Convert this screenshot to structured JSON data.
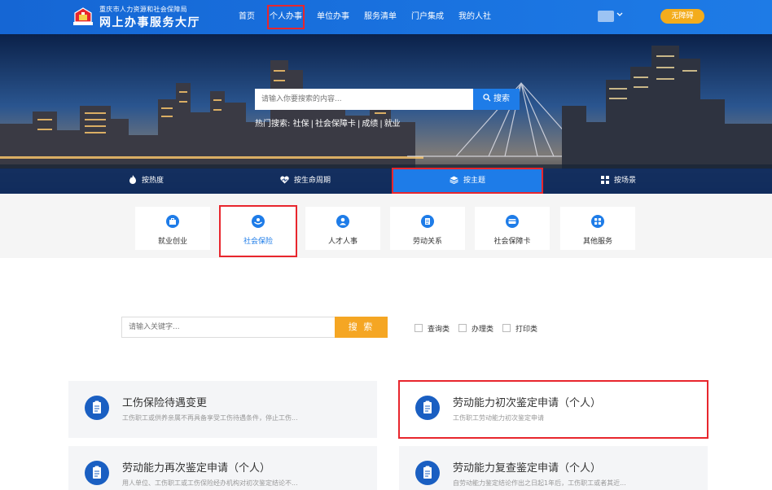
{
  "header": {
    "brand_sub": "重庆市人力资源和社会保障局",
    "brand_title": "网上办事服务大厅",
    "nav": [
      "首页",
      "个人办事",
      "单位办事",
      "服务清单",
      "门户集成",
      "我的人社"
    ],
    "active_nav": "个人办事",
    "access_label": "无障碍"
  },
  "hero": {
    "search_placeholder": "请输入你要搜索的内容...",
    "search_button": "搜索",
    "hot_label": "热门搜索:",
    "hot_items": [
      "社保",
      "社会保障卡",
      "成绩",
      "就业"
    ],
    "tabs": [
      "按热度",
      "按生命周期",
      "按主题",
      "按场景"
    ],
    "active_tab": "按主题"
  },
  "categories": {
    "items": [
      "就业创业",
      "社会保险",
      "人才人事",
      "劳动关系",
      "社会保障卡",
      "其他服务"
    ],
    "active": "社会保险"
  },
  "filter": {
    "placeholder": "请输入关键字...",
    "button": "搜 索",
    "checkboxes": [
      "查询类",
      "办理类",
      "打印类"
    ]
  },
  "cards": [
    {
      "title": "工伤保险待遇变更",
      "desc": "工伤职工或供养亲属不再具备享受工伤待遇条件，停止工伤..."
    },
    {
      "title": "劳动能力初次鉴定申请（个人）",
      "desc": "工伤职工劳动能力初次鉴定申请"
    },
    {
      "title": "劳动能力再次鉴定申请（个人）",
      "desc": "用人单位、工伤职工或工伤保险经办机构对初次鉴定结论不..."
    },
    {
      "title": "劳动能力复查鉴定申请（个人）",
      "desc": "自劳动能力鉴定结论作出之日起1年后，工伤职工或者其近..."
    }
  ],
  "colors": {
    "primary": "#1e7ce8",
    "accent": "#f5a623",
    "highlight": "#e8262d"
  }
}
